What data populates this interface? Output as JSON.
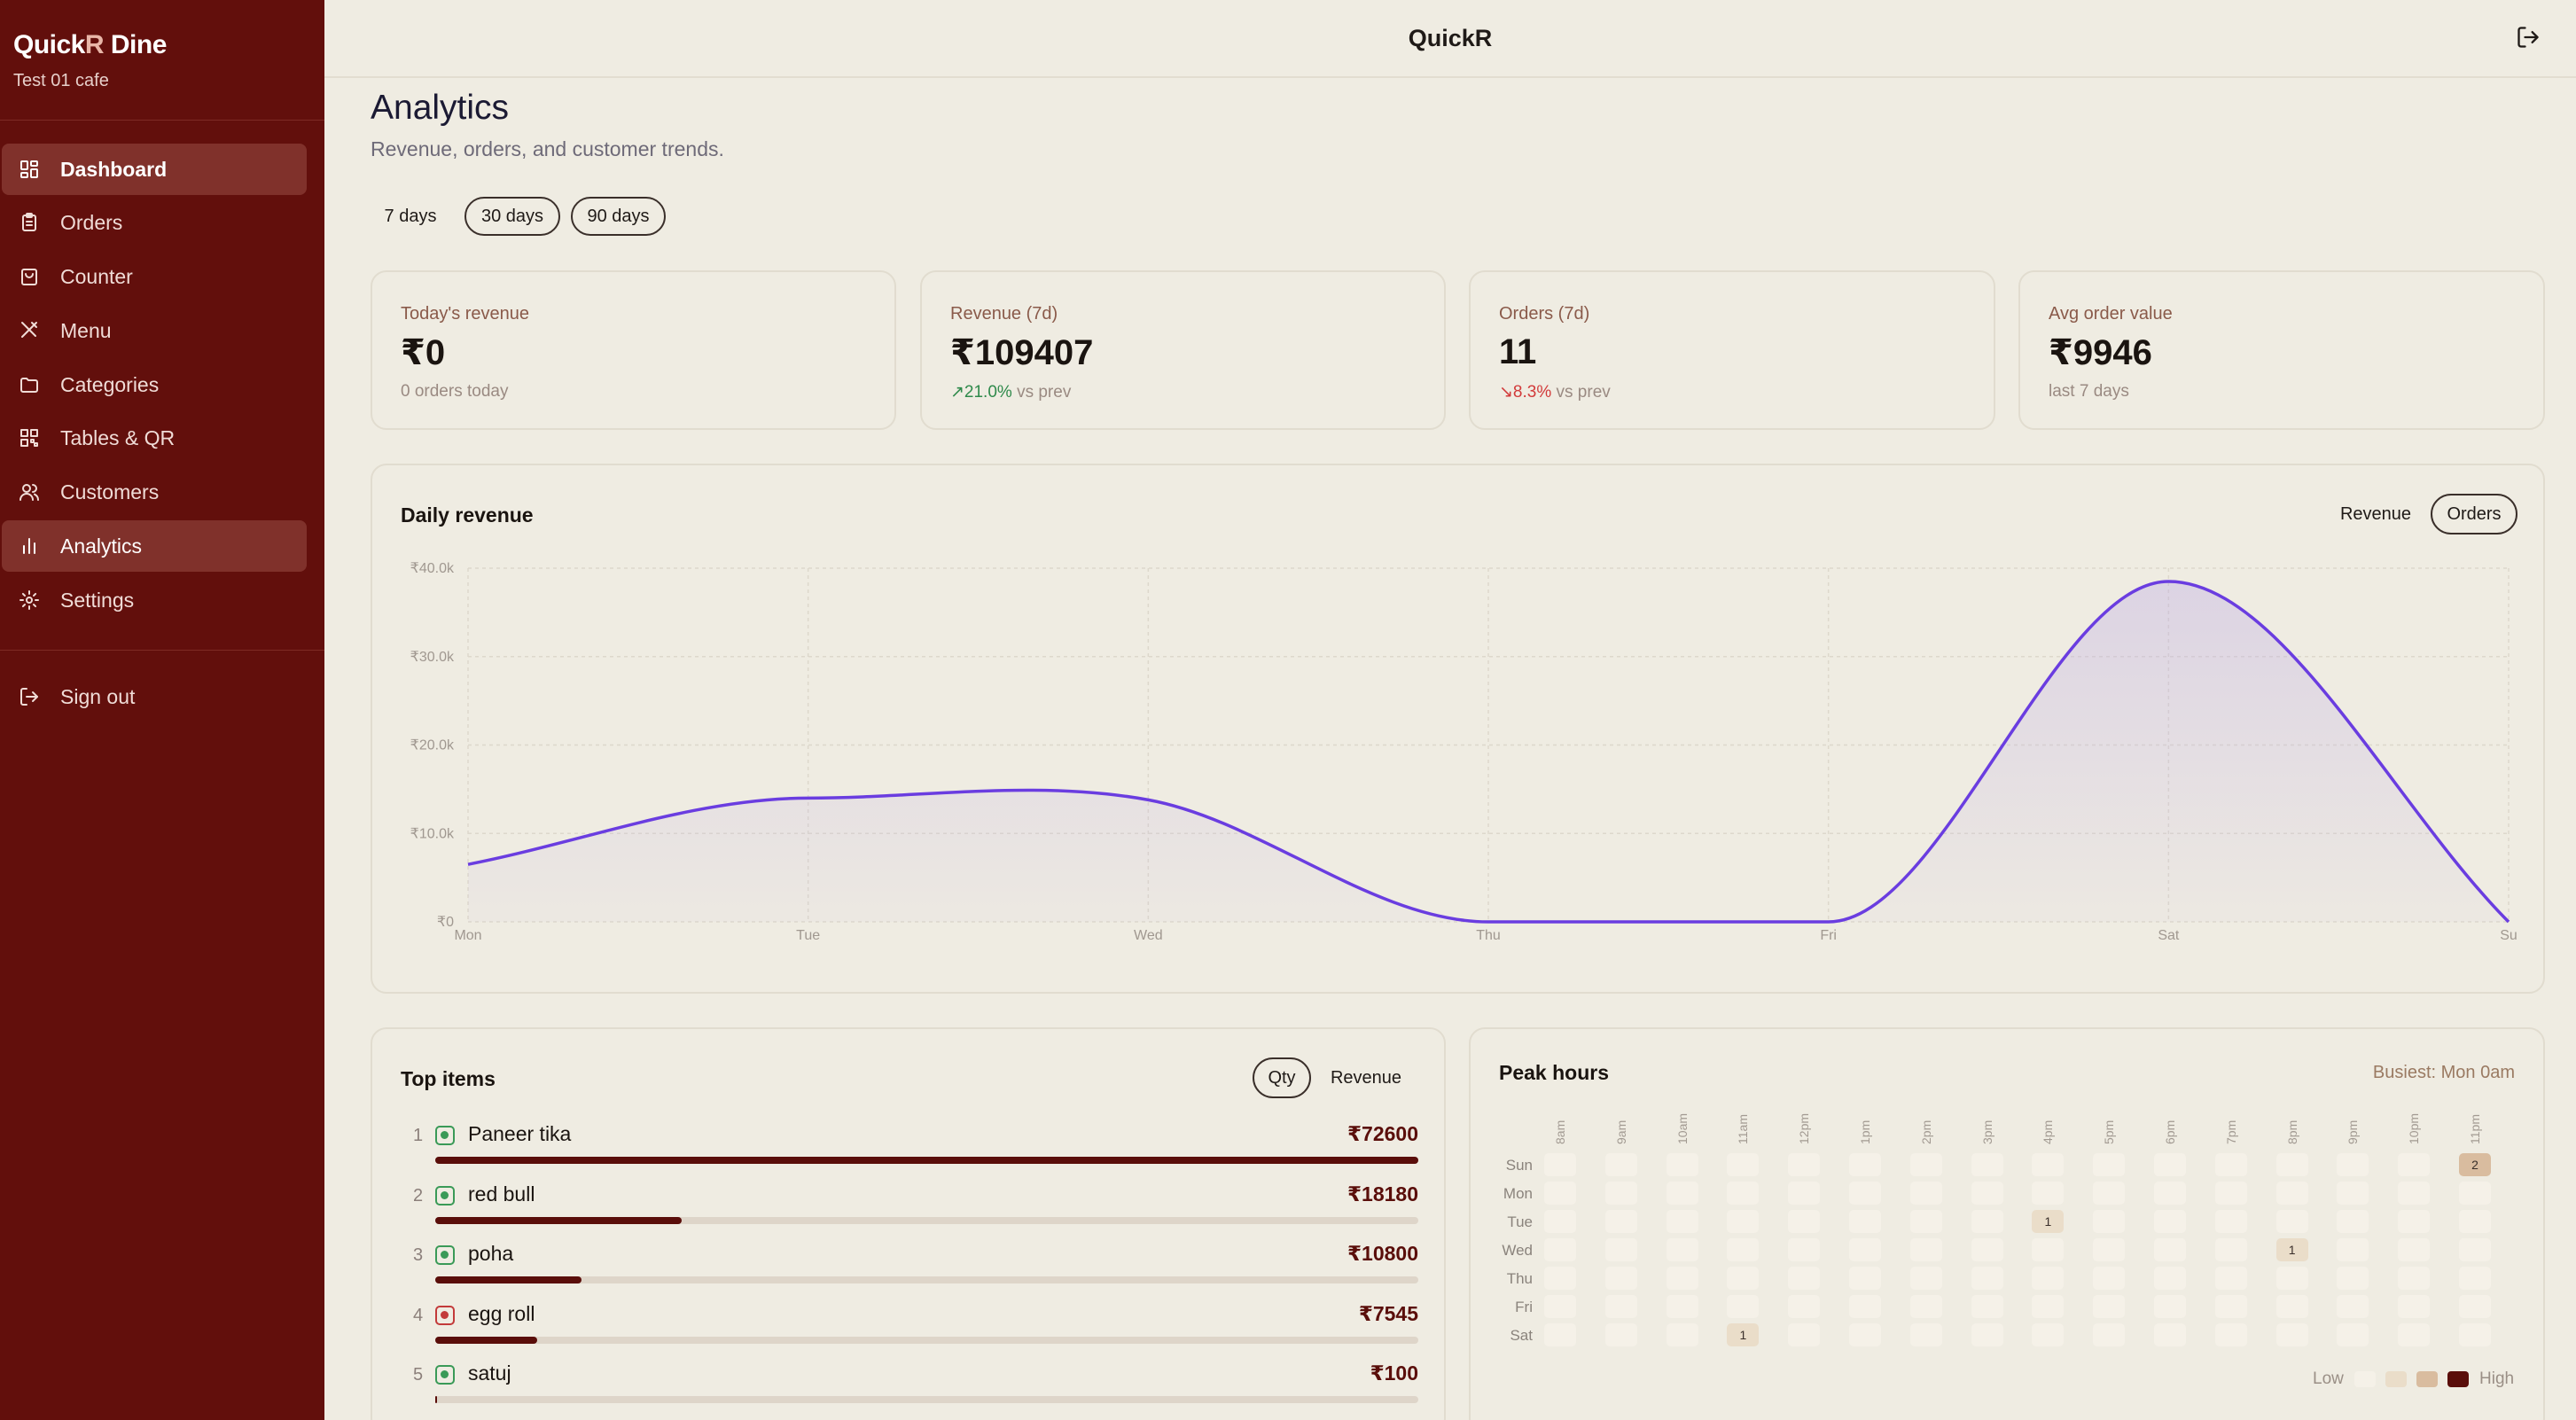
{
  "brand": {
    "name_a": "Quick",
    "name_b": "R",
    "name_c": " Dine",
    "subtitle": "Test 01 cafe"
  },
  "nav": [
    {
      "label": "Dashboard",
      "icon": "dashboard-icon",
      "active": true
    },
    {
      "label": "Orders",
      "icon": "clipboard-icon"
    },
    {
      "label": "Counter",
      "icon": "shopping-bag-icon"
    },
    {
      "label": "Menu",
      "icon": "utensils-icon"
    },
    {
      "label": "Categories",
      "icon": "folder-icon"
    },
    {
      "label": "Tables & QR",
      "icon": "qr-code-icon"
    },
    {
      "label": "Customers",
      "icon": "users-icon"
    },
    {
      "label": "Analytics",
      "icon": "bar-chart-icon",
      "active": true
    },
    {
      "label": "Settings",
      "icon": "gear-icon"
    },
    {
      "label": "Sign out",
      "icon": "logout-icon"
    }
  ],
  "header": {
    "title": "QuickR"
  },
  "page": {
    "title": "Analytics",
    "subtitle": "Revenue, orders, and customer trends."
  },
  "ranges": [
    {
      "label": "7 days",
      "selected": true
    },
    {
      "label": "30 days"
    },
    {
      "label": "90 days"
    }
  ],
  "stats": [
    {
      "label": "Today's revenue",
      "value": "₹0",
      "foot": "0 orders today"
    },
    {
      "label": "Revenue (7d)",
      "value": "₹109407",
      "change": "21.0%",
      "direction": "up",
      "suffix": "vs prev"
    },
    {
      "label": "Orders (7d)",
      "value": "11",
      "change": "8.3%",
      "direction": "down",
      "suffix": "vs prev"
    },
    {
      "label": "Avg order value",
      "value": "₹9946",
      "foot": "last 7 days"
    }
  ],
  "daily": {
    "title": "Daily revenue",
    "toggle_revenue": "Revenue",
    "toggle_orders": "Orders"
  },
  "chart_data": {
    "type": "area",
    "title": "Daily revenue",
    "categories": [
      "Mon",
      "Tue",
      "Wed",
      "Thu",
      "Fri",
      "Sat",
      "Su"
    ],
    "values": [
      6500,
      14000,
      13800,
      0,
      0,
      38500,
      0
    ],
    "ylim": [
      0,
      40000
    ],
    "yticks": [
      0,
      10000,
      20000,
      30000,
      40000
    ],
    "ytick_labels": [
      "₹0",
      "₹10.0k",
      "₹20.0k",
      "₹30.0k",
      "₹40.0k"
    ],
    "grid": true,
    "line_color": "#6a3de0"
  },
  "top_items": {
    "title": "Top items",
    "toggle_qty": "Qty",
    "toggle_revenue": "Revenue",
    "items": [
      {
        "rank": "1",
        "name": "Paneer tika",
        "value": "₹72600",
        "amount": 72600,
        "veg": true
      },
      {
        "rank": "2",
        "name": "red bull",
        "value": "₹18180",
        "amount": 18180,
        "veg": true
      },
      {
        "rank": "3",
        "name": "poha",
        "value": "₹10800",
        "amount": 10800,
        "veg": true
      },
      {
        "rank": "4",
        "name": "egg roll",
        "value": "₹7545",
        "amount": 7545,
        "veg": false
      },
      {
        "rank": "5",
        "name": "satuj",
        "value": "₹100",
        "amount": 100,
        "veg": true
      }
    ]
  },
  "peak": {
    "title": "Peak hours",
    "busiest": "Busiest: Mon 0am",
    "hours": [
      "8am",
      "9am",
      "10am",
      "11am",
      "12pm",
      "1pm",
      "2pm",
      "3pm",
      "4pm",
      "5pm",
      "6pm",
      "7pm",
      "8pm",
      "9pm",
      "10pm",
      "11pm"
    ],
    "days": [
      "Sun",
      "Mon",
      "Tue",
      "Wed",
      "Thu",
      "Fri",
      "Sat"
    ],
    "counts": [
      [
        0,
        0,
        0,
        0,
        0,
        0,
        0,
        0,
        0,
        0,
        0,
        0,
        0,
        0,
        0,
        2
      ],
      [
        0,
        0,
        0,
        0,
        0,
        0,
        0,
        0,
        0,
        0,
        0,
        0,
        0,
        0,
        0,
        0
      ],
      [
        0,
        0,
        0,
        0,
        0,
        0,
        0,
        0,
        1,
        0,
        0,
        0,
        0,
        0,
        0,
        0
      ],
      [
        0,
        0,
        0,
        0,
        0,
        0,
        0,
        0,
        0,
        0,
        0,
        0,
        1,
        0,
        0,
        0
      ],
      [
        0,
        0,
        0,
        0,
        0,
        0,
        0,
        0,
        0,
        0,
        0,
        0,
        0,
        0,
        0,
        0
      ],
      [
        0,
        0,
        0,
        0,
        0,
        0,
        0,
        0,
        0,
        0,
        0,
        0,
        0,
        0,
        0,
        0
      ],
      [
        0,
        0,
        0,
        1,
        0,
        0,
        0,
        0,
        0,
        0,
        0,
        0,
        0,
        0,
        0,
        0
      ]
    ],
    "legend_low": "Low",
    "legend_high": "High",
    "legend_colors": [
      "#f5f1e8",
      "#eaddc9",
      "#d9bc9f",
      "#5a0e0a"
    ]
  }
}
